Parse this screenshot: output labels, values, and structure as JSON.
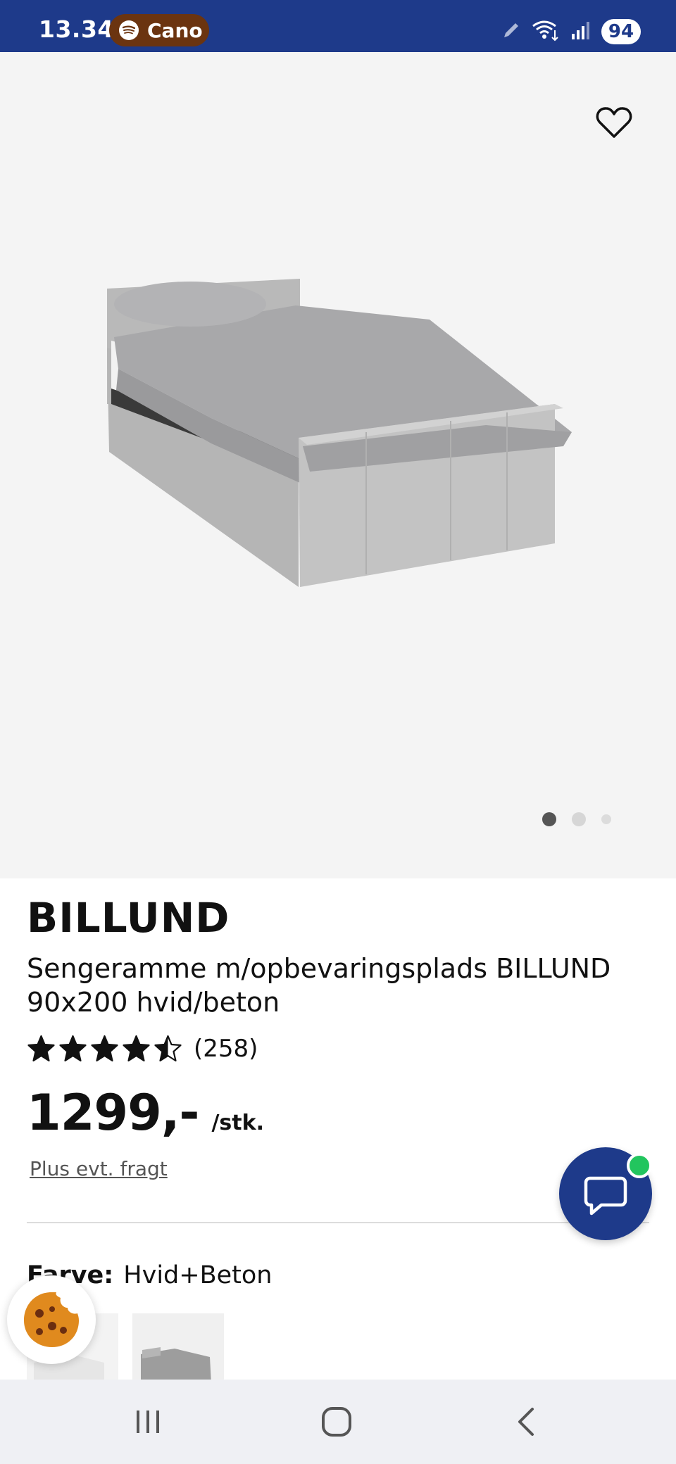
{
  "status_bar": {
    "time": "13.34",
    "now_playing_app": "Cano",
    "battery": "94",
    "icons": [
      "spotify-icon",
      "pen-icon",
      "wifi-icon",
      "signal-icon",
      "battery-icon"
    ]
  },
  "hero": {
    "image_subject": "bed-frame-image",
    "carousel": {
      "total": 3,
      "active": 1
    }
  },
  "product": {
    "brand": "BILLUND",
    "name": "Sengeramme m/opbevaringsplads BILLUND 90x200 hvid/beton",
    "rating": 4.5,
    "rating_max": 5,
    "review_count": "(258)",
    "price": "1299,-",
    "unit": "/stk.",
    "shipping_note": "Plus evt. fragt",
    "color_label": "Farve:",
    "color_value": "Hvid+Beton"
  },
  "colors": {
    "brand_blue": "#1e3a8a",
    "online_green": "#22c55e",
    "hero_bg": "#f4f4f4"
  }
}
